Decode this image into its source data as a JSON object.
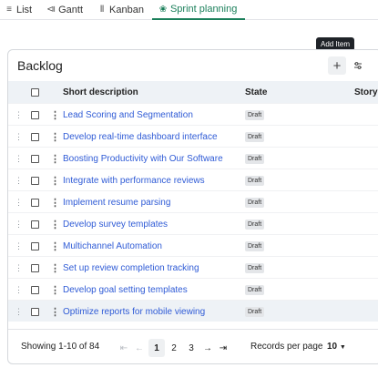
{
  "tabs": [
    {
      "label": "List",
      "icon": "list-icon",
      "glyph": "≡",
      "active": false
    },
    {
      "label": "Gantt",
      "icon": "gantt-icon",
      "glyph": "⧏",
      "active": false
    },
    {
      "label": "Kanban",
      "icon": "kanban-icon",
      "glyph": "Ⅱ",
      "active": false
    },
    {
      "label": "Sprint planning",
      "icon": "sprint-icon",
      "glyph": "❀",
      "active": true
    }
  ],
  "tooltip": "Add Item",
  "backlog": {
    "title": "Backlog",
    "columns": {
      "description": "Short description",
      "state": "State",
      "story": "Story points"
    },
    "rows": [
      {
        "description": "Lead Scoring and Segmentation",
        "state": "Draft"
      },
      {
        "description": "Develop real-time dashboard interface",
        "state": "Draft"
      },
      {
        "description": "Boosting Productivity with Our Software",
        "state": "Draft"
      },
      {
        "description": "Integrate with performance reviews",
        "state": "Draft"
      },
      {
        "description": "Implement resume parsing",
        "state": "Draft"
      },
      {
        "description": "Develop survey templates",
        "state": "Draft"
      },
      {
        "description": "Multichannel Automation",
        "state": "Draft"
      },
      {
        "description": "Set up review completion tracking",
        "state": "Draft"
      },
      {
        "description": "Develop goal setting templates",
        "state": "Draft"
      },
      {
        "description": "Optimize reports for mobile viewing",
        "state": "Draft"
      }
    ]
  },
  "footer": {
    "showing": "Showing 1-10 of 84",
    "pages": [
      "1",
      "2",
      "3"
    ],
    "current_page": "1",
    "records_label": "Records per page",
    "records_value": "10"
  },
  "colors": {
    "accent": "#1a7f5a",
    "link": "#2f5bd6",
    "header_bg": "#eef2f6"
  }
}
